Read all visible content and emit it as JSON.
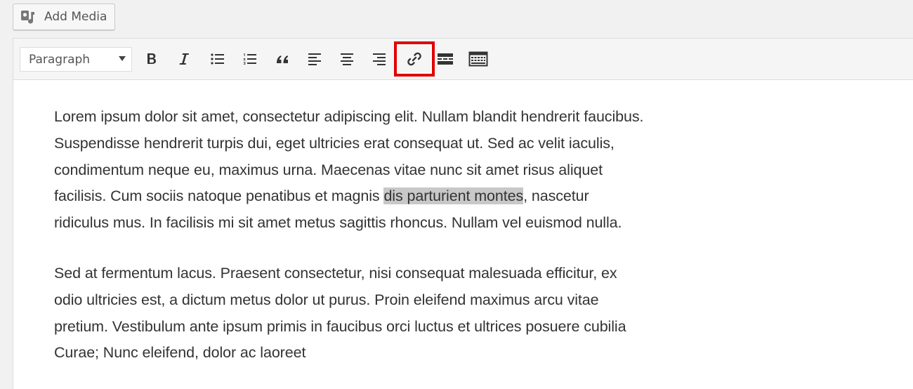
{
  "toolbar_top": {
    "add_media_label": "Add Media",
    "add_media_icon": "media-icon"
  },
  "editor_toolbar": {
    "format_select_value": "Paragraph",
    "buttons": [
      {
        "name": "bold",
        "icon": "bold-icon"
      },
      {
        "name": "italic",
        "icon": "italic-icon"
      },
      {
        "name": "bulleted-list",
        "icon": "bullet-list-icon"
      },
      {
        "name": "numbered-list",
        "icon": "numbered-list-icon"
      },
      {
        "name": "blockquote",
        "icon": "quote-icon"
      },
      {
        "name": "align-left",
        "icon": "align-left-icon"
      },
      {
        "name": "align-center",
        "icon": "align-center-icon"
      },
      {
        "name": "align-right",
        "icon": "align-right-icon"
      },
      {
        "name": "insert-link",
        "icon": "link-icon",
        "highlighted": true
      },
      {
        "name": "read-more",
        "icon": "read-more-icon"
      },
      {
        "name": "toolbar-toggle",
        "icon": "toolbar-toggle-icon"
      }
    ],
    "highlight_color": "#e00000"
  },
  "content": {
    "paragraph1": {
      "before": "Lorem ipsum dolor sit amet, consectetur adipiscing elit. Nullam blandit hendrerit faucibus. Suspendisse hendrerit turpis dui, eget ultricies erat consequat ut. Sed ac velit iaculis, condimentum neque eu, maximus urna. Maecenas vitae nunc sit amet risus aliquet facilisis. Cum sociis natoque penatibus et magnis ",
      "selected": "dis parturient montes",
      "after": ", nascetur ridiculus mus. In facilisis mi sit amet metus sagittis rhoncus. Nullam vel euismod nulla."
    },
    "paragraph2": "Sed at fermentum lacus. Praesent consectetur, nisi consequat malesuada efficitur, ex odio ultricies est, a dictum metus dolor ut purus. Proin eleifend maximus arcu vitae pretium. Vestibulum ante ipsum primis in faucibus orci luctus et ultrices posuere cubilia Curae; Nunc eleifend, dolor ac laoreet"
  }
}
